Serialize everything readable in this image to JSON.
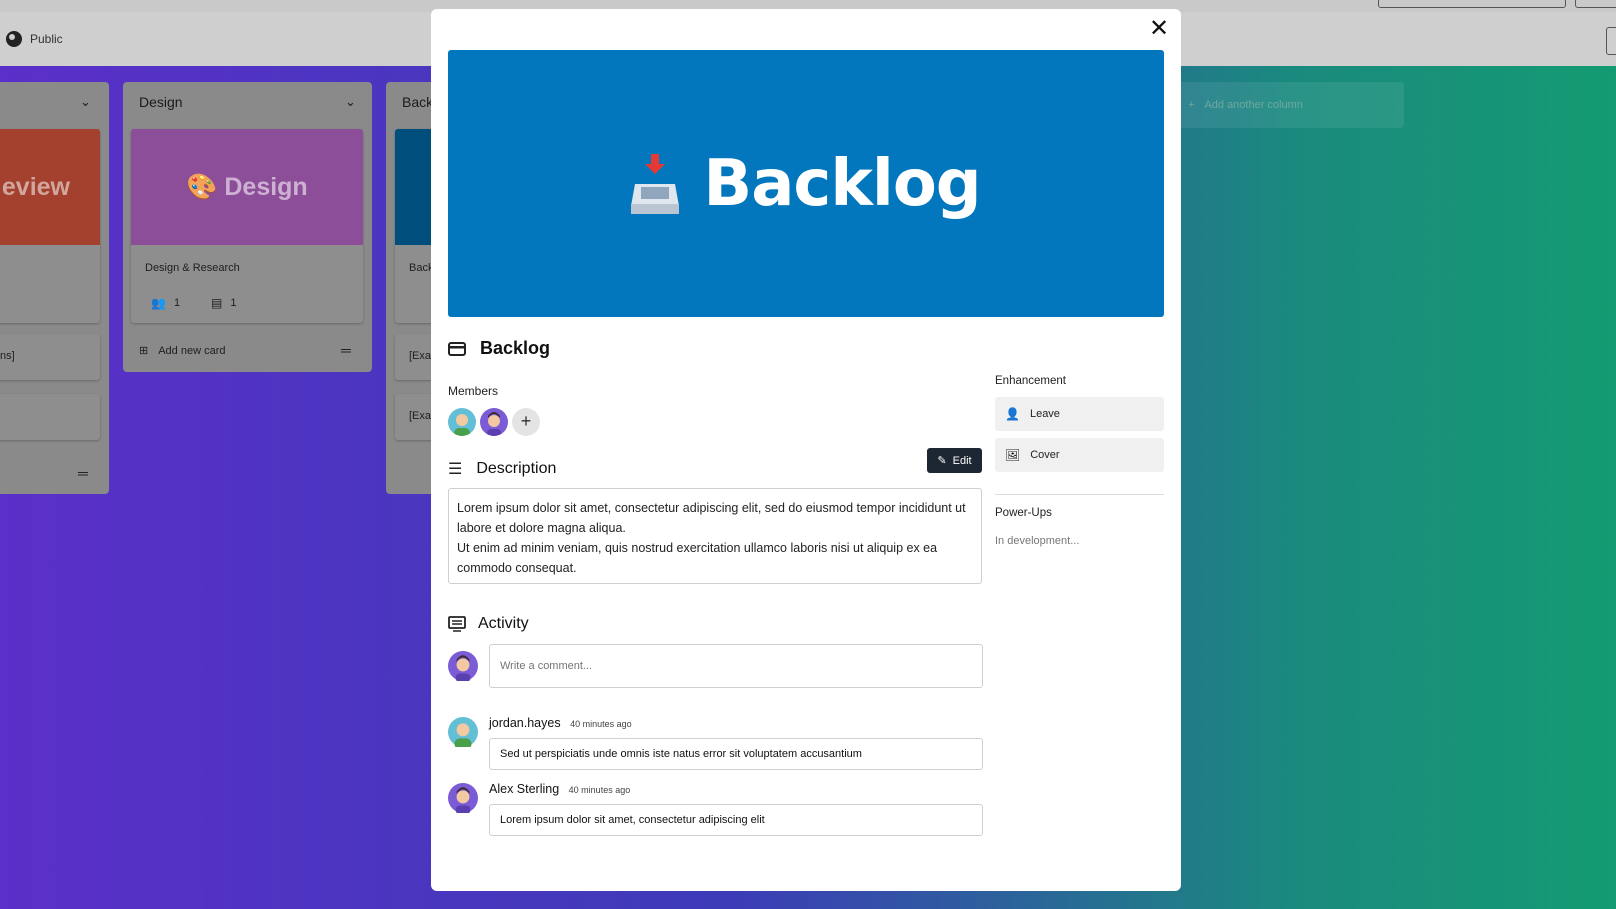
{
  "board": {
    "visibility_label": "Public",
    "columns": [
      {
        "id": "review",
        "title": "",
        "cover_text": "eview",
        "card_text": "",
        "partial_card_1": "ns]",
        "partial_card_2": ""
      },
      {
        "id": "design",
        "title": "Design",
        "cover_text": "🎨 Design",
        "card_text": "Design & Research",
        "members_count": "1",
        "comments_count": "1",
        "add_card_label": "Add new card"
      },
      {
        "id": "backlog",
        "title": "Back",
        "card_text": "Back",
        "partial_card_1": "[Exa",
        "partial_card_2": "[Exa"
      }
    ],
    "add_column_label": "Add another column"
  },
  "modal": {
    "cover_title": "Backlog",
    "card_title": "Backlog",
    "members_label": "Members",
    "description_title": "Description",
    "edit_label": "Edit",
    "description_lines": [
      "Lorem ipsum dolor sit amet, consectetur adipiscing elit, sed do eiusmod tempor incididunt ut labore et dolore magna aliqua.",
      "Ut enim ad minim veniam, quis nostrud exercitation ullamco laboris nisi ut aliquip ex ea commodo consequat."
    ],
    "activity_title": "Activity",
    "comment_placeholder": "Write a comment...",
    "comments": [
      {
        "author": "jordan.hayes",
        "time": "40 minutes ago",
        "text": "Sed ut perspiciatis unde omnis iste natus error sit voluptatem accusantium"
      },
      {
        "author": "Alex Sterling",
        "time": "40 minutes ago",
        "text": "Lorem ipsum dolor sit amet, consectetur adipiscing elit"
      }
    ],
    "sidebar": {
      "enhancement_label": "Enhancement",
      "leave_label": "Leave",
      "cover_label": "Cover",
      "powerups_label": "Power-Ups",
      "powerups_status": "In development..."
    }
  },
  "colors": {
    "cover_blue": "#0277bd",
    "edit_button": "#1d2633"
  }
}
